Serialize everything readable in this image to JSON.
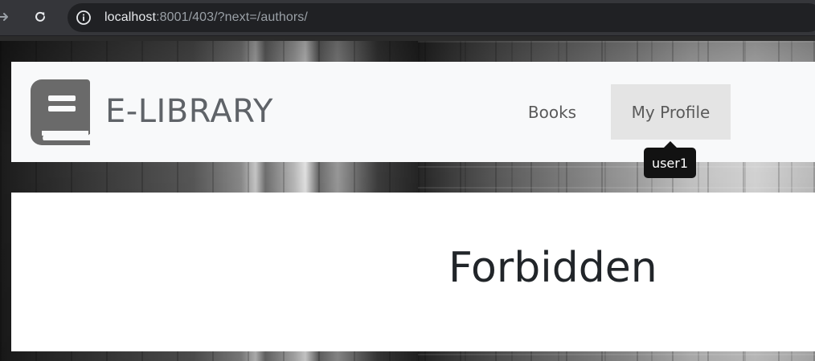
{
  "browser": {
    "url_host": "localhost",
    "url_path": ":8001/403/?next=/authors/"
  },
  "site": {
    "brand": "E-LIBRARY",
    "nav": [
      {
        "label": "Books"
      },
      {
        "label": "My Profile"
      }
    ],
    "tooltip": "user1"
  },
  "main": {
    "heading": "Forbidden"
  },
  "colors": {
    "navbar_bg": "#f8f9fa",
    "active_nav_bg": "#e4e4e4",
    "brand_text": "#5f6368",
    "tooltip_bg": "#121212",
    "heading_text": "#212529"
  }
}
